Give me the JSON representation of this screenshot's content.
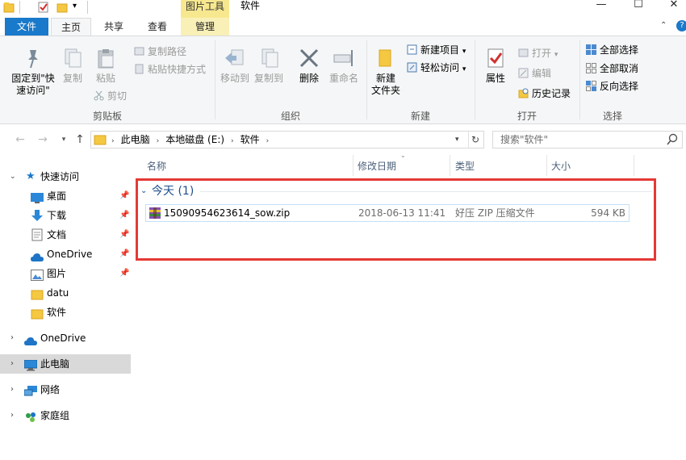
{
  "window": {
    "title": "软件",
    "tool_tab": "图片工具",
    "controls": {
      "minimize": "—",
      "maximize": "☐",
      "close": "✕"
    }
  },
  "ribbon_tabs": {
    "file": "文件",
    "home": "主页",
    "share": "共享",
    "view": "查看",
    "manage": "管理"
  },
  "ribbon": {
    "clipboard": {
      "pin_quick": "固定到\"快\n速访问\"",
      "copy": "复制",
      "paste": "粘贴",
      "copy_path": "复制路径",
      "paste_shortcut": "粘贴快捷方式",
      "cut": "剪切",
      "label": "剪贴板"
    },
    "organize": {
      "move_to": "移动到",
      "copy_to": "复制到",
      "delete": "删除",
      "rename": "重命名",
      "label": "组织"
    },
    "new": {
      "new_folder": "新建\n文件夹",
      "new_item": "新建项目",
      "easy_access": "轻松访问",
      "label": "新建"
    },
    "open": {
      "properties": "属性",
      "open": "打开",
      "edit": "编辑",
      "history": "历史记录",
      "label": "打开"
    },
    "select": {
      "select_all": "全部选择",
      "select_none": "全部取消",
      "invert": "反向选择",
      "label": "选择"
    }
  },
  "address": {
    "crumbs": [
      "此电脑",
      "本地磁盘 (E:)",
      "软件"
    ],
    "search_placeholder": "搜索\"软件\""
  },
  "nav": {
    "quick_access": "快速访问",
    "quick_items": [
      {
        "label": "桌面"
      },
      {
        "label": "下载"
      },
      {
        "label": "文档"
      },
      {
        "label": "OneDrive"
      },
      {
        "label": "图片"
      },
      {
        "label": "datu"
      },
      {
        "label": "软件"
      }
    ],
    "onedrive": "OneDrive",
    "this_pc": "此电脑",
    "network": "网络",
    "homegroup": "家庭组"
  },
  "columns": {
    "name": "名称",
    "date": "修改日期",
    "type": "类型",
    "size": "大小"
  },
  "group": {
    "label": "今天 (1)"
  },
  "files": [
    {
      "name": "15090954623614_sow.zip",
      "date": "2018-06-13 11:41",
      "type": "好压 ZIP 压缩文件",
      "size": "594 KB"
    }
  ],
  "colors": {
    "accent": "#1979ca",
    "highlight_border": "#e53935",
    "tool_tab": "#f7e88f"
  }
}
